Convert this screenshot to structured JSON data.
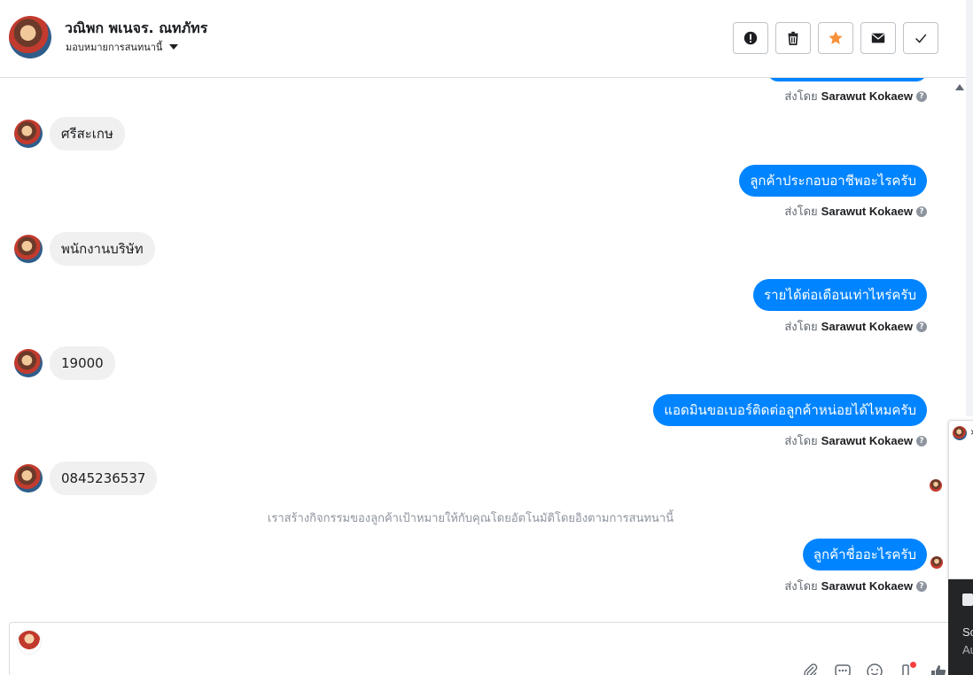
{
  "header": {
    "name": "วณิพก พเนจร. ณทภัทร",
    "subtitle": "มอบหมายการสนทนานี้",
    "actions": [
      {
        "name": "mark-spam-button",
        "icon": "exclamation-icon"
      },
      {
        "name": "delete-button",
        "icon": "trash-icon"
      },
      {
        "name": "star-button",
        "icon": "star-icon"
      },
      {
        "name": "mark-unread-button",
        "icon": "envelope-icon"
      },
      {
        "name": "mark-done-button",
        "icon": "check-icon"
      }
    ]
  },
  "sent_by_prefix": "ส่งโดย",
  "agent_name": "Sarawut Kokaew",
  "messages": {
    "m1_in": "ศรีสะเกษ",
    "m2_out": "ลูกค้าประกอบอาชีพอะไรครับ",
    "m3_in": "พนักงานบริษัท",
    "m4_out": "รายได้ต่อเดือนเท่าไหร่ครับ",
    "m5_in": "19000",
    "m6_out": "แอดมินขอเบอร์ติดต่อลูกค้าหน่อยได้ไหมครับ",
    "m7_in": "0845236537",
    "system_note": "เราสร้างกิจกรรมของลูกค้าเป้าหมายให้กับคุณโดยอัตโนมัติโดยอิงตามการสนทนานี้",
    "m8_out": "ลูกค้าชื่ออะไรครับ"
  },
  "composer": {
    "placeholder": "",
    "tools": [
      "paperclip-icon",
      "saved-reply-icon",
      "emoji-icon",
      "app-icon",
      "thumbs-up-icon"
    ]
  },
  "side_panel": {
    "close_glyph": "×",
    "line1": "So",
    "line2": "Au"
  },
  "colors": {
    "outgoing": "#0084ff",
    "incoming": "#f0f0f0",
    "star": "#f7923a"
  }
}
